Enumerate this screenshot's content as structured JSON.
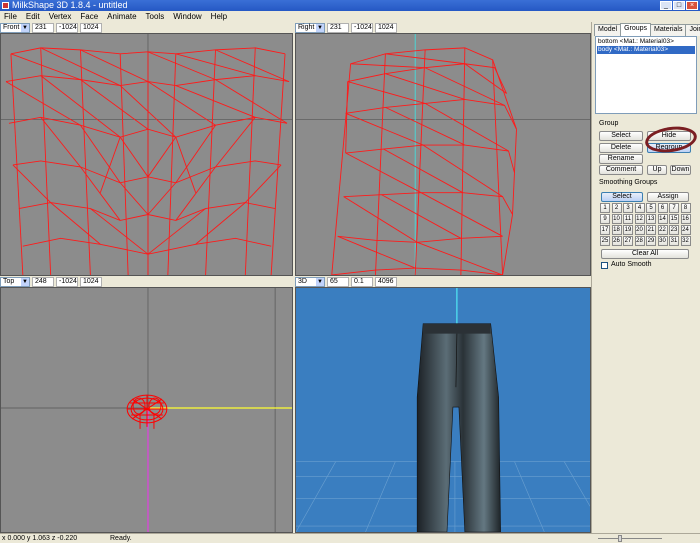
{
  "window": {
    "title": "MilkShape 3D 1.8.4 - untitled",
    "controls": [
      "_",
      "□",
      "×"
    ]
  },
  "menu": [
    "File",
    "Edit",
    "Vertex",
    "Face",
    "Animate",
    "Tools",
    "Window",
    "Help"
  ],
  "viewports": [
    {
      "view": "Front",
      "fields": [
        "231",
        "-1024",
        "1024"
      ]
    },
    {
      "view": "Right",
      "fields": [
        "231",
        "-1024",
        "1024"
      ]
    },
    {
      "view": "Top",
      "fields": [
        "248",
        "-1024",
        "1024"
      ]
    },
    {
      "view": "3D",
      "fields": [
        "65",
        "0.1",
        "4096"
      ]
    }
  ],
  "panel": {
    "tabs": [
      "Model",
      "Groups",
      "Materials",
      "Joints"
    ],
    "active_tab": "Groups",
    "groups_list": [
      {
        "label": "bottom <Mat.: Material03>",
        "selected": false
      },
      {
        "label": "body <Mat.: Material03>",
        "selected": true
      }
    ],
    "group_section": "Group",
    "group_buttons": {
      "select": "Select",
      "hide": "Hide",
      "delete": "Delete",
      "regroup": "Regroup",
      "rename": "Rename",
      "comment": "Comment",
      "up": "Up",
      "down": "Down"
    },
    "smoothing_section": "Smoothing Groups",
    "smoothing_select": "Select",
    "smoothing_assign": "Assign",
    "smoothing_numbers": [
      "1",
      "2",
      "3",
      "4",
      "5",
      "6",
      "7",
      "8",
      "9",
      "10",
      "11",
      "12",
      "13",
      "14",
      "15",
      "16",
      "17",
      "18",
      "19",
      "20",
      "21",
      "22",
      "23",
      "24",
      "25",
      "26",
      "27",
      "28",
      "29",
      "30",
      "31",
      "32"
    ],
    "clear_all": "Clear All",
    "auto_smooth": "Auto Smooth"
  },
  "status": {
    "coords": "x 0.000 y 1.063 z -0.220",
    "message": "Ready."
  },
  "colors": {
    "wireframe": "#ff0000",
    "viewport_bg": "#8c8c8c",
    "view3d_bg": "#3a7ec0",
    "annotation": "#7a1e22",
    "selection": "#316ac5"
  }
}
